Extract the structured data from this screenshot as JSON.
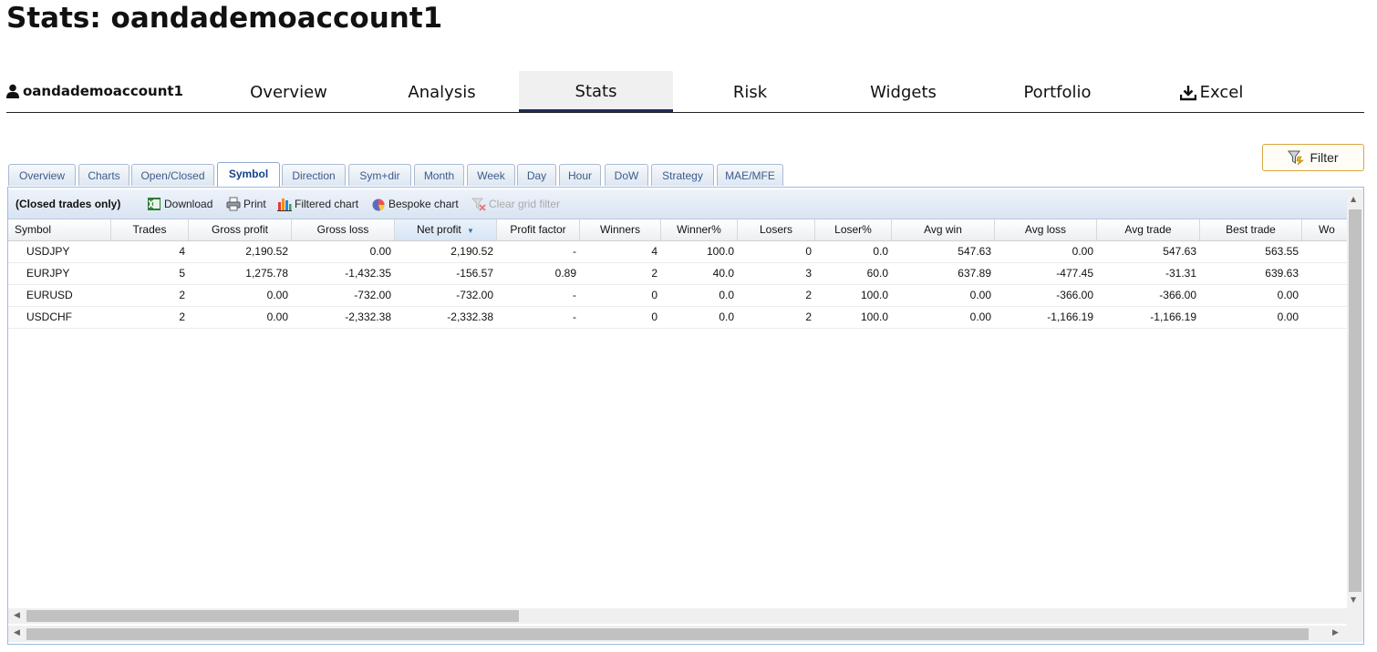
{
  "page": {
    "title": "Stats: oandademoaccount1"
  },
  "nav": {
    "account": "oandademoaccount1",
    "tabs": [
      "Overview",
      "Analysis",
      "Stats",
      "Risk",
      "Widgets",
      "Portfolio",
      "Excel"
    ],
    "active_tab": "Stats"
  },
  "filter": {
    "label": "Filter"
  },
  "subtabs": {
    "items": [
      "Overview",
      "Charts",
      "Open/Closed",
      "Symbol",
      "Direction",
      "Sym+dir",
      "Month",
      "Week",
      "Day",
      "Hour",
      "DoW",
      "Strategy",
      "MAE/MFE"
    ],
    "active": "Symbol"
  },
  "toolbar": {
    "title": "(Closed trades only)",
    "download": "Download",
    "print": "Print",
    "filtered_chart": "Filtered chart",
    "bespoke_chart": "Bespoke chart",
    "clear_filter": "Clear grid filter"
  },
  "table": {
    "columns": [
      "Symbol",
      "Trades",
      "Gross profit",
      "Gross loss",
      "Net profit",
      "Profit factor",
      "Winners",
      "Winner%",
      "Losers",
      "Loser%",
      "Avg win",
      "Avg loss",
      "Avg trade",
      "Best trade",
      "Wo"
    ],
    "sorted_column": "Net profit",
    "rows": [
      [
        "USDJPY",
        "4",
        "2,190.52",
        "0.00",
        "2,190.52",
        "-",
        "4",
        "100.0",
        "0",
        "0.0",
        "547.63",
        "0.00",
        "547.63",
        "563.55"
      ],
      [
        "EURJPY",
        "5",
        "1,275.78",
        "-1,432.35",
        "-156.57",
        "0.89",
        "2",
        "40.0",
        "3",
        "60.0",
        "637.89",
        "-477.45",
        "-31.31",
        "639.63"
      ],
      [
        "EURUSD",
        "2",
        "0.00",
        "-732.00",
        "-732.00",
        "-",
        "0",
        "0.0",
        "2",
        "100.0",
        "0.00",
        "-366.00",
        "-366.00",
        "0.00"
      ],
      [
        "USDCHF",
        "2",
        "0.00",
        "-2,332.38",
        "-2,332.38",
        "-",
        "0",
        "0.0",
        "2",
        "100.0",
        "0.00",
        "-1,166.19",
        "-1,166.19",
        "0.00"
      ]
    ]
  }
}
